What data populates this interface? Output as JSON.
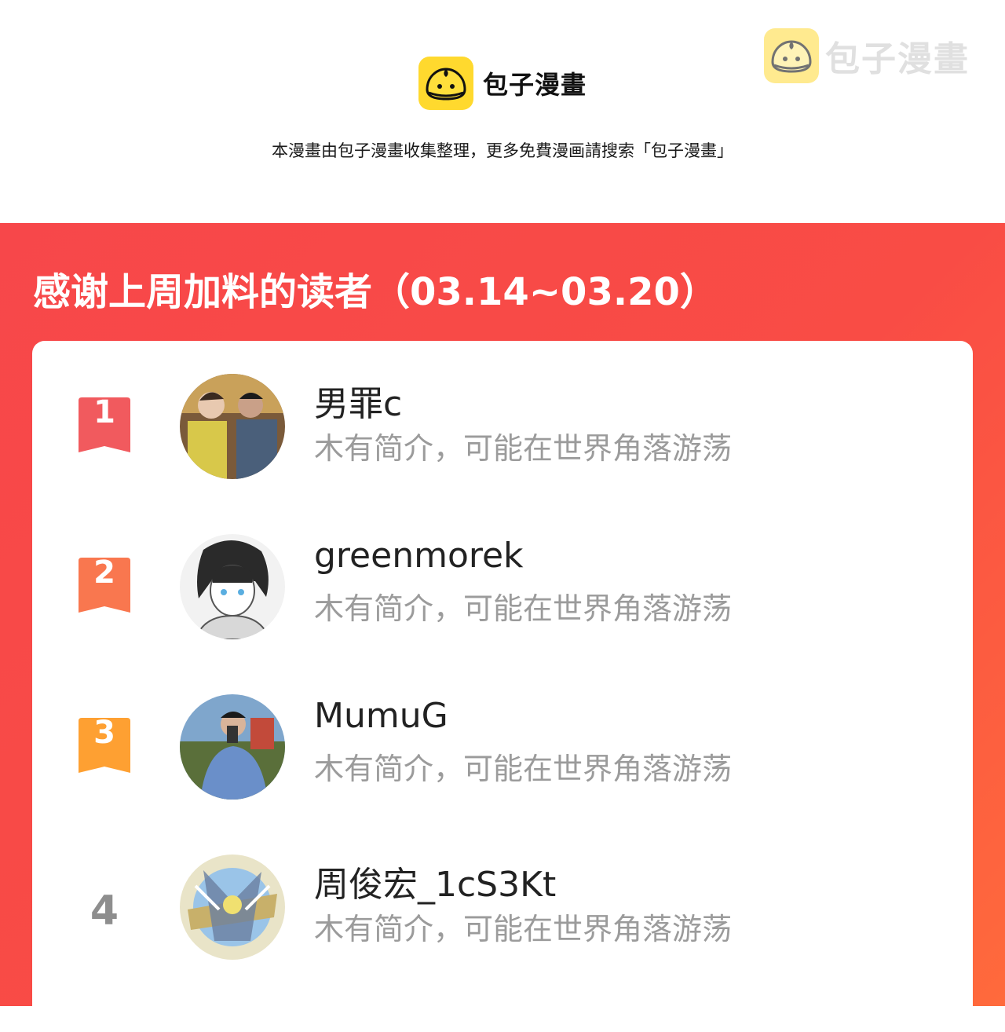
{
  "header": {
    "brand_name": "包子漫畫",
    "subtitle": "本漫畫由包子漫畫收集整理，更多免費漫画請搜索「包子漫畫」",
    "watermark_text": "包子漫畫",
    "logo_icon": "bun-mascot-icon"
  },
  "banner": {
    "title": "感谢上周加料的读者（03.14~03.20）"
  },
  "rankings": [
    {
      "rank": "1",
      "username": "男罪c",
      "bio": "木有简介，可能在世界角落游荡"
    },
    {
      "rank": "2",
      "username": "greenmorek",
      "bio": "木有简介，可能在世界角落游荡"
    },
    {
      "rank": "3",
      "username": "MumuG",
      "bio": "木有简介，可能在世界角落游荡"
    },
    {
      "rank": "4",
      "username": "周俊宏_1cS3Kt",
      "bio": "木有简介，可能在世界角落游荡"
    }
  ],
  "colors": {
    "banner_red": "#f7474a",
    "banner_orange": "#ff6a3c",
    "logo_yellow": "#ffd92e",
    "rank1": "#f15a5e",
    "rank2": "#f9774f",
    "rank3": "#fea032",
    "bio_gray": "#9b9b9b"
  }
}
